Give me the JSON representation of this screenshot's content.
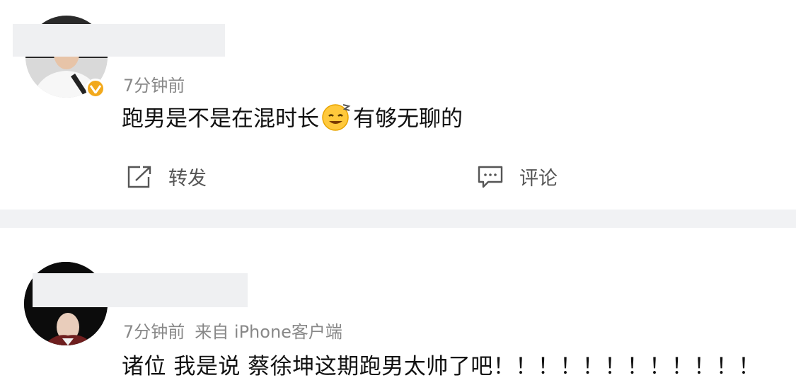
{
  "posts": [
    {
      "time": "7分钟前",
      "text_before_emoji": "跑男是不是在混时长",
      "emoji": "dizzy-smile-emoji",
      "text_after_emoji": "有够无聊的",
      "actions": {
        "repost_label": "转发",
        "comment_label": "评论"
      }
    },
    {
      "time": "7分钟前",
      "source": "来自 iPhone客户端",
      "text": "诸位 我是说 蔡徐坤这期跑男太帅了吧！！！！！！！！！！！！"
    }
  ],
  "colors": {
    "badge": "#f2a91c",
    "separator": "#f1f2f4",
    "meta": "#888888"
  }
}
